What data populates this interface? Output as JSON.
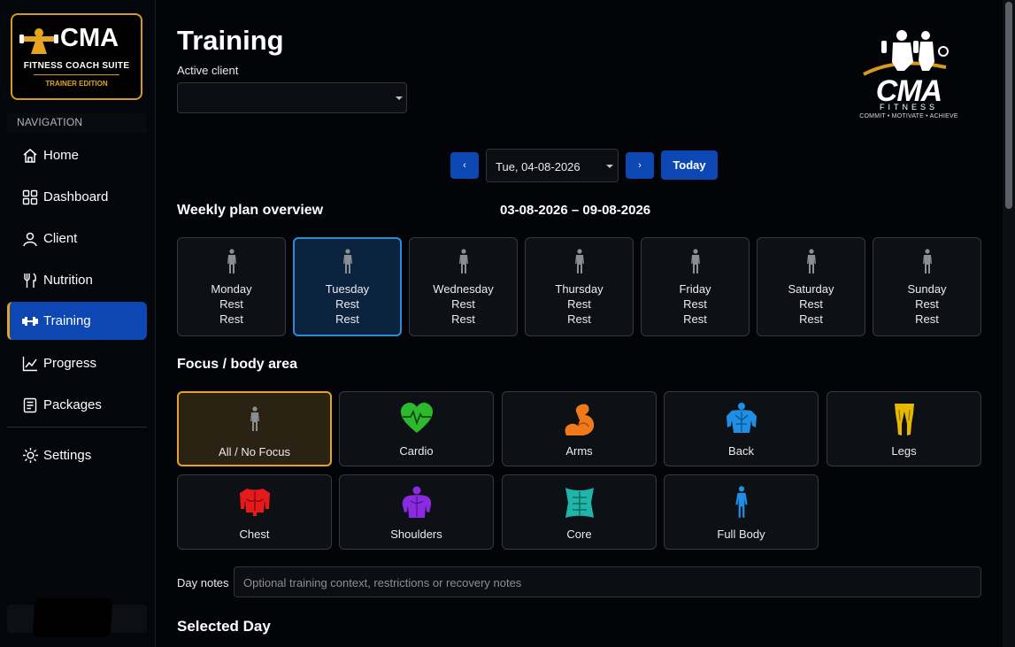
{
  "sidebar": {
    "logo": {
      "title": "CMA",
      "subtitle": "FITNESS COACH SUITE",
      "edition": "TRAINER EDITION"
    },
    "nav_heading": "NAVIGATION",
    "items": [
      {
        "label": "Home",
        "icon": "home-icon"
      },
      {
        "label": "Dashboard",
        "icon": "dashboard-icon"
      },
      {
        "label": "Client",
        "icon": "client-icon"
      },
      {
        "label": "Nutrition",
        "icon": "nutrition-icon"
      },
      {
        "label": "Training",
        "icon": "dumbbell-icon",
        "active": true
      },
      {
        "label": "Progress",
        "icon": "progress-chart-icon"
      },
      {
        "label": "Packages",
        "icon": "packages-icon"
      }
    ],
    "settings": {
      "label": "Settings",
      "icon": "gear-icon"
    }
  },
  "header": {
    "title": "Training",
    "client_label": "Active client",
    "client_value": ""
  },
  "brand": {
    "name": "CMA",
    "sub": "FITNESS",
    "tagline": "COMMIT • MOTIVATE • ACHIEVE"
  },
  "date_nav": {
    "prev": "‹",
    "date": "Tue, 04-08-2026",
    "next": "›",
    "today": "Today"
  },
  "weekly": {
    "heading": "Weekly plan overview",
    "range": "03-08-2026 – 09-08-2026",
    "days": [
      {
        "name": "Monday",
        "l1": "Rest",
        "l2": "Rest"
      },
      {
        "name": "Tuesday",
        "l1": "Rest",
        "l2": "Rest",
        "selected": true
      },
      {
        "name": "Wednesday",
        "l1": "Rest",
        "l2": "Rest"
      },
      {
        "name": "Thursday",
        "l1": "Rest",
        "l2": "Rest"
      },
      {
        "name": "Friday",
        "l1": "Rest",
        "l2": "Rest"
      },
      {
        "name": "Saturday",
        "l1": "Rest",
        "l2": "Rest"
      },
      {
        "name": "Sunday",
        "l1": "Rest",
        "l2": "Rest"
      }
    ]
  },
  "focus": {
    "heading": "Focus / body area",
    "areas": [
      {
        "label": "All / No Focus",
        "icon": "body-figure-icon",
        "color": "#8a8f96",
        "selected": true
      },
      {
        "label": "Cardio",
        "icon": "heart-icon",
        "color": "#2eb82e"
      },
      {
        "label": "Arms",
        "icon": "arm-icon",
        "color": "#f07a1a"
      },
      {
        "label": "Back",
        "icon": "back-icon",
        "color": "#1f8fe6"
      },
      {
        "label": "Legs",
        "icon": "legs-icon",
        "color": "#e6b800"
      },
      {
        "label": "Chest",
        "icon": "chest-icon",
        "color": "#e61a1a"
      },
      {
        "label": "Shoulders",
        "icon": "shoulders-icon",
        "color": "#8a2be2"
      },
      {
        "label": "Core",
        "icon": "core-icon",
        "color": "#1fb5a8"
      },
      {
        "label": "Full Body",
        "icon": "full-body-icon",
        "color": "#1f8fe6"
      }
    ]
  },
  "notes": {
    "label": "Day notes",
    "placeholder": "Optional training context, restrictions or recovery notes"
  },
  "selected_day_heading": "Selected Day",
  "colors": {
    "accent": "#0d47b4",
    "gold": "#e6a31e",
    "background": "#020407"
  }
}
